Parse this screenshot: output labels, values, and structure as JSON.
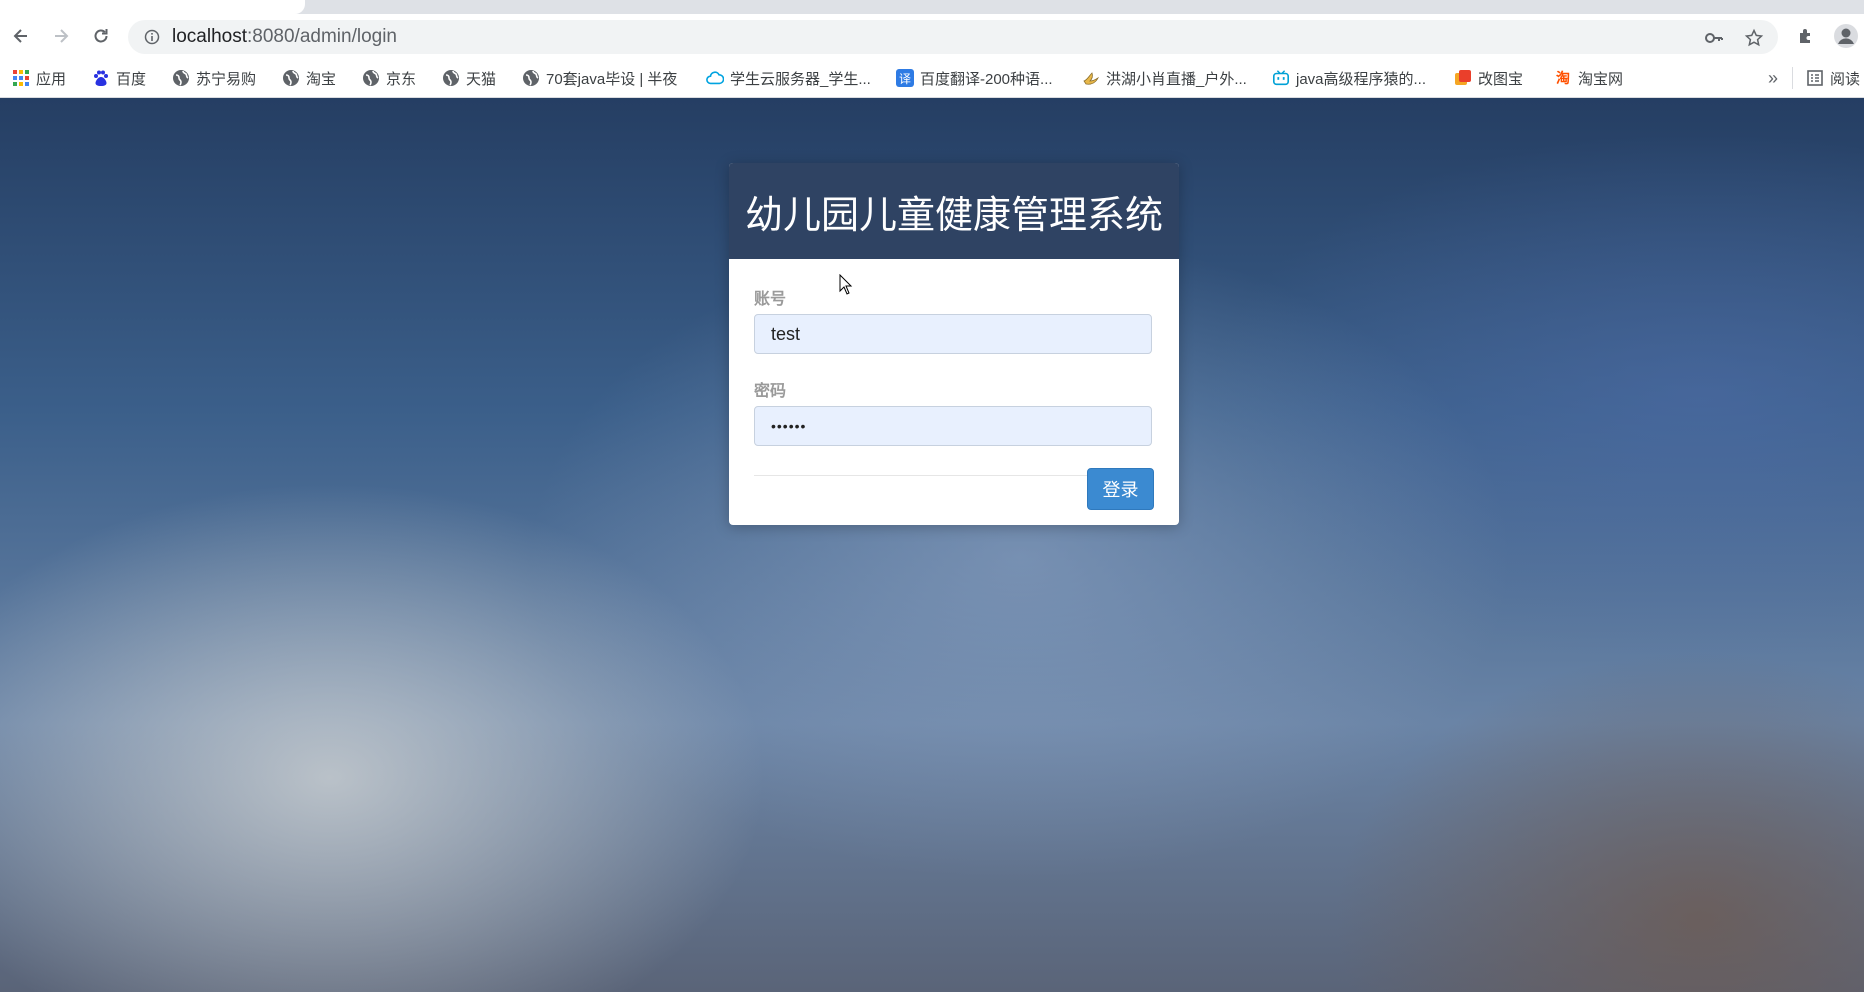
{
  "browser": {
    "url_host": "localhost",
    "url_path": ":8080/admin/login",
    "toolbar_icons": [
      "back-icon",
      "forward-icon",
      "reload-icon",
      "site-info-icon",
      "password-key-icon",
      "bookmark-star-icon",
      "extensions-icon",
      "profile-icon"
    ]
  },
  "bookmarks": [
    {
      "label": "应用",
      "icon": "apps-grid-icon"
    },
    {
      "label": "百度",
      "icon": "baidu-icon"
    },
    {
      "label": "苏宁易购",
      "icon": "globe-icon"
    },
    {
      "label": "淘宝",
      "icon": "globe-icon"
    },
    {
      "label": "京东",
      "icon": "globe-icon"
    },
    {
      "label": "天猫",
      "icon": "globe-icon"
    },
    {
      "label": "70套java毕设 | 半夜",
      "icon": "globe-icon"
    },
    {
      "label": "学生云服务器_学生...",
      "icon": "cloud-icon"
    },
    {
      "label": "百度翻译-200种语...",
      "icon": "translate-icon"
    },
    {
      "label": "洪湖小肖直播_户外...",
      "icon": "bird-icon"
    },
    {
      "label": "java高级程序猿的...",
      "icon": "bilibili-icon"
    },
    {
      "label": "改图宝",
      "icon": "gaitubao-icon"
    },
    {
      "label": "淘宝网",
      "icon": "taobao-icon"
    }
  ],
  "bookmarks_overflow": "»",
  "reading_list_label": "阅读",
  "login": {
    "title": "幼儿园儿童健康管理系统",
    "account_label": "账号",
    "account_value": "test",
    "password_label": "密码",
    "password_value": "••••••",
    "submit_label": "登录"
  },
  "colors": {
    "header_bg": "#2f4363",
    "button_bg": "#3b8ad1",
    "input_bg": "#e8f0fe"
  }
}
